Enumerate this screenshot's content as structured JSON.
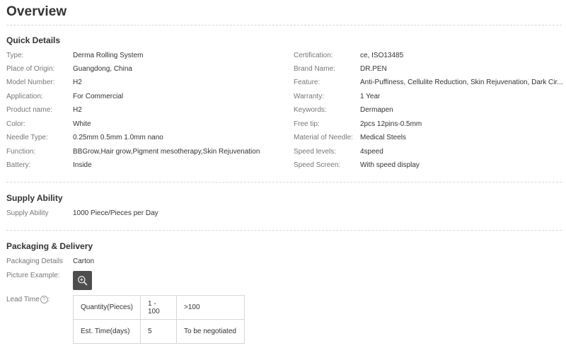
{
  "title": "Overview",
  "quick_details": {
    "heading": "Quick Details",
    "left": [
      {
        "label": "Type:",
        "value": "Derma Rolling System"
      },
      {
        "label": "Place of Origin:",
        "value": "Guangdong, China"
      },
      {
        "label": "Model Number:",
        "value": "H2"
      },
      {
        "label": "Application:",
        "value": "For Commercial"
      },
      {
        "label": "Product name:",
        "value": "H2"
      },
      {
        "label": "Color:",
        "value": "White"
      },
      {
        "label": "Needle Type:",
        "value": "0.25mm 0.5mm 1.0mm nano"
      },
      {
        "label": "Function:",
        "value": "BBGrow,Hair grow,Pigment mesotherapy,Skin Rejuvenation"
      },
      {
        "label": "Battery:",
        "value": "Inside"
      }
    ],
    "right": [
      {
        "label": "Certification:",
        "value": "ce, ISO13485"
      },
      {
        "label": "Brand Name:",
        "value": "DR.PEN"
      },
      {
        "label": "Feature:",
        "value": "Anti-Puffiness, Cellulite Reduction, Skin Rejuvenation, Dark Cir..."
      },
      {
        "label": "Warranty:",
        "value": "1 Year"
      },
      {
        "label": "Keywords:",
        "value": "Dermapen"
      },
      {
        "label": "Free tip:",
        "value": "2pcs 12pins-0.5mm"
      },
      {
        "label": "Material of Needle:",
        "value": "Medical Steels"
      },
      {
        "label": "Speed levels:",
        "value": "4speed"
      },
      {
        "label": "Speed Screen:",
        "value": "With speed display"
      }
    ]
  },
  "supply_ability": {
    "heading": "Supply Ability",
    "label": "Supply Ability",
    "value": "1000 Piece/Pieces per Day"
  },
  "packaging": {
    "heading": "Packaging & Delivery",
    "details_label": "Packaging Details",
    "details_value": "Carton",
    "picture_label": "Picture Example:",
    "lead_time_label": "Lead Time",
    "help_glyph": "?",
    "zoom_icon": "zoom-in-icon",
    "lead_table": [
      [
        "Quantity(Pieces)",
        "1 - 100",
        ">100"
      ],
      [
        "Est. Time(days)",
        "5",
        "To be negotiated"
      ]
    ]
  }
}
